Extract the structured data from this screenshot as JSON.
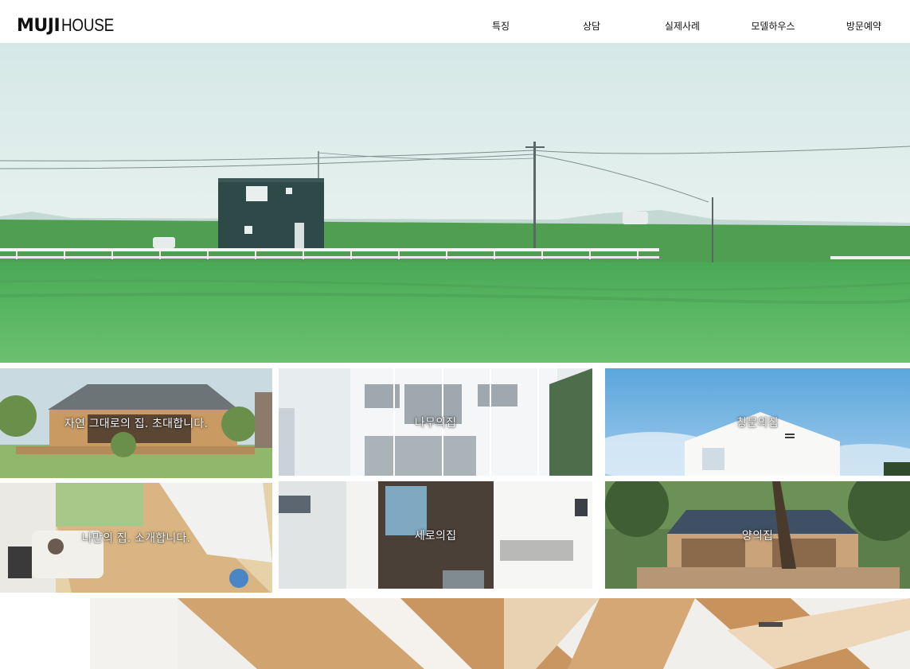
{
  "header": {
    "logo_bold": "MUJI",
    "logo_light": "HOUSE",
    "nav": [
      {
        "label": "특징"
      },
      {
        "label": "상담"
      },
      {
        "label": "실제사례"
      },
      {
        "label": "모델하우스"
      },
      {
        "label": "방문예약"
      }
    ]
  },
  "tiles": [
    {
      "label": "자연 그대로의 집. 초대합니다."
    },
    {
      "label": "나무의집"
    },
    {
      "label": "창문의집"
    },
    {
      "label": "나만의 집. 소개합니다."
    },
    {
      "label": "세로의집"
    },
    {
      "label": "양의집"
    }
  ],
  "colors": {
    "sky": "#d8ebea",
    "field": "#55b35e",
    "house_dark": "#2d4a48"
  }
}
